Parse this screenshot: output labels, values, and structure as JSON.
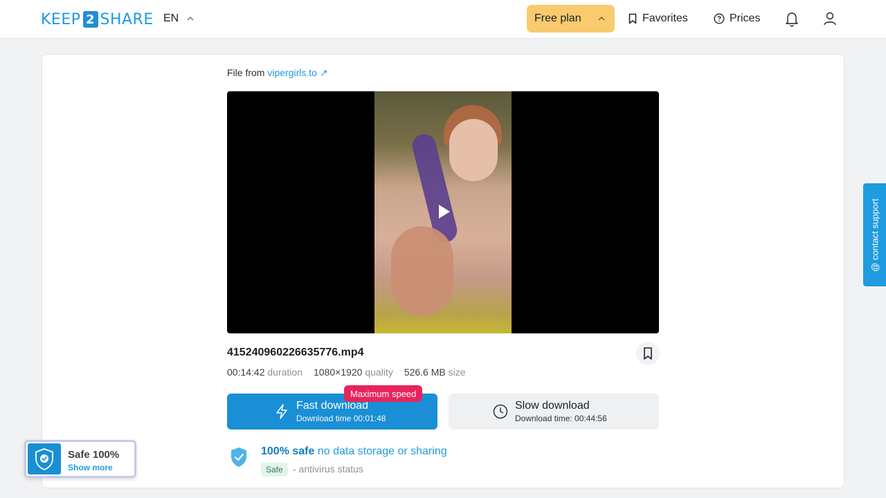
{
  "header": {
    "logo": {
      "left": "KEEP",
      "mid": "2",
      "right": "SHARE"
    },
    "language": "EN",
    "free_plan_label": "Free plan",
    "favorites_label": "Favorites",
    "prices_label": "Prices"
  },
  "file": {
    "from_prefix": "File from",
    "source_link": "vipergirls.to",
    "name": "415240960226635776.mp4",
    "duration": "00:14:42",
    "duration_label": "duration",
    "quality": "1080×1920",
    "quality_label": "quality",
    "size": "526.6 MB",
    "size_label": "size"
  },
  "download": {
    "fast_title": "Fast download",
    "fast_sub": "Download time 00:01:48",
    "badge": "Maximum speed",
    "slow_title": "Slow download",
    "slow_sub": "Download time: 00:44:56"
  },
  "safety": {
    "strong": "100% safe",
    "rest": "no data storage or sharing",
    "tag": "Safe",
    "status": "- antivirus status"
  },
  "contact_support": "@ contact support",
  "safe_widget": {
    "title": "Safe 100%",
    "link": "Show more"
  },
  "colors": {
    "accent": "#1f9be0",
    "fast_button": "#1a8fd5",
    "free_plan": "#f9cb6e",
    "badge": "#e8245c"
  }
}
